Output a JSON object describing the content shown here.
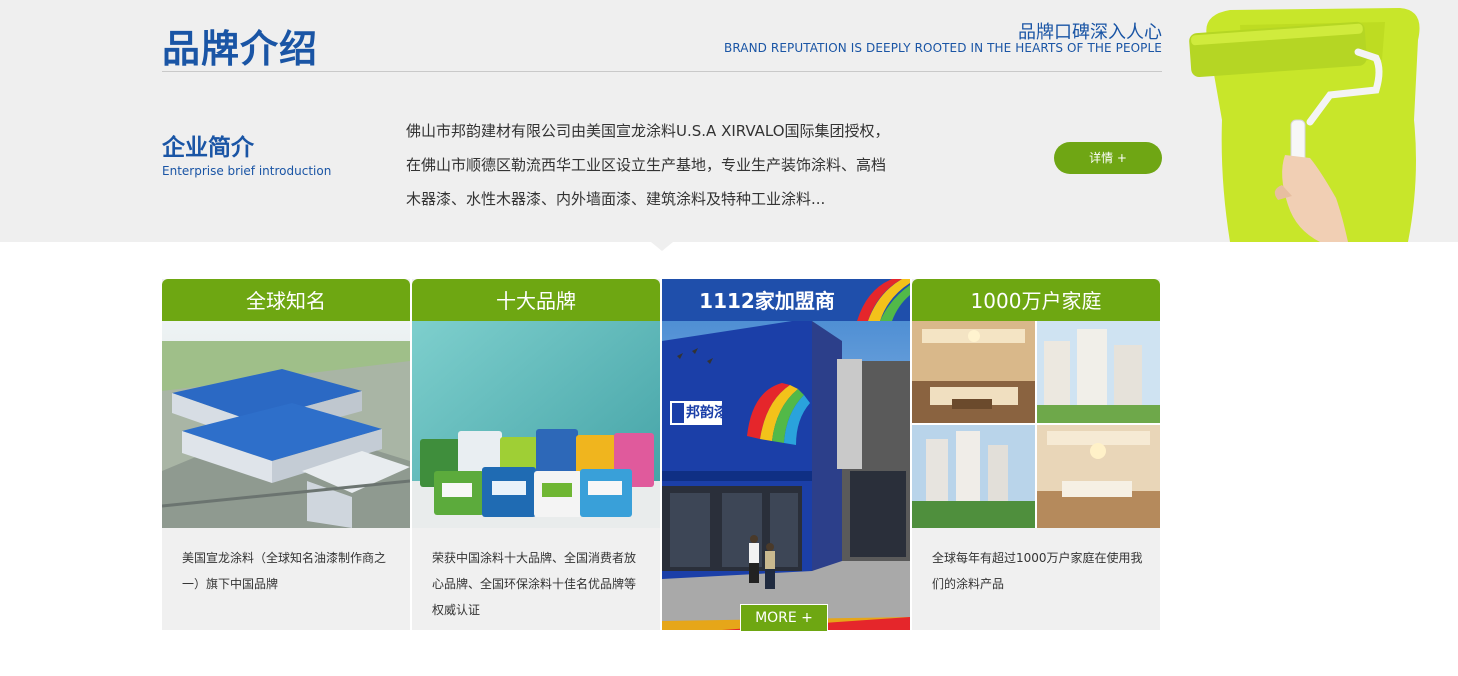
{
  "header": {
    "title": "品牌介绍",
    "slogan_cn": "品牌口碑深入人心",
    "slogan_en": "BRAND REPUTATION IS DEEPLY ROOTED IN THE HEARTS OF THE PEOPLE"
  },
  "intro": {
    "title": "企业简介",
    "subtitle": "Enterprise brief introduction",
    "text": "佛山市邦韵建材有限公司由美国宣龙涂料U.S.A XIRVALO国际集团授权，在佛山市顺德区勒流西华工业区设立生产基地，专业生产装饰涂料、高档木器漆、水性木器漆、内外墙面漆、建筑涂料及特种工业涂料...",
    "detail_label": "详情 +"
  },
  "cards": [
    {
      "heading": "全球知名",
      "text": "美国宣龙涂料（全球知名油漆制作商之一）旗下中国品牌"
    },
    {
      "heading": "十大品牌",
      "text": "荣获中国涂料十大品牌、全国消费者放心品牌、全国环保涂料十佳名优品牌等权威认证"
    },
    {
      "heading": "1112家加盟商",
      "more_label": "MORE +",
      "store_sign": "邦韵漆"
    },
    {
      "heading": "1000万户家庭",
      "text": "全球每年有超过1000万户家庭在使用我们的涂料产品"
    }
  ],
  "colors": {
    "brand_blue": "#1a55a5",
    "accent_green": "#6ea712",
    "band_grey": "#efefef"
  }
}
